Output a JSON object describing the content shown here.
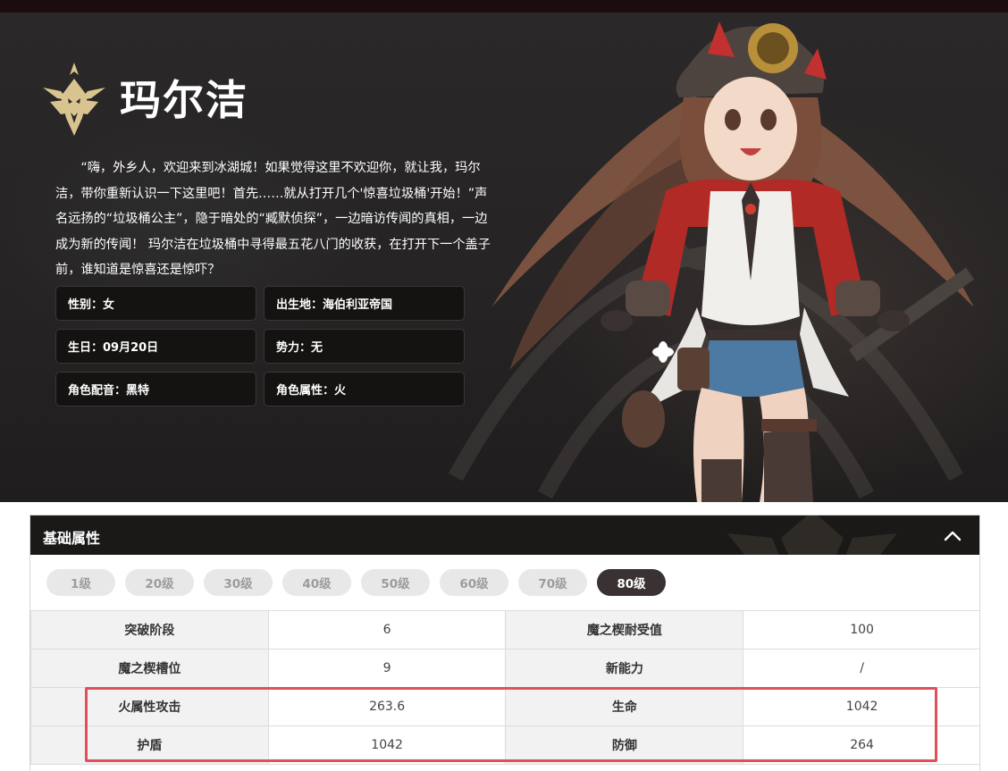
{
  "character": {
    "name": "玛尔洁",
    "bio": "“嗨，外乡人，欢迎来到冰湖城！如果觉得这里不欢迎你，就让我，玛尔洁，带你重新认识一下这里吧！首先……就从打开几个'惊喜垃圾桶'开始！”声名远扬的“垃圾桶公主”，隐于暗处的“臧默侦探”，一边暗访传闻的真相，一边成为新的传闻！ 玛尔洁在垃圾桶中寻得最五花八门的收获，在打开下一个盖子前，谁知道是惊喜还是惊吓？",
    "info": [
      {
        "label": "性别：女"
      },
      {
        "label": "出生地：海伯利亚帝国"
      },
      {
        "label": "生日：09月20日"
      },
      {
        "label": "势力：无"
      },
      {
        "label": "角色配音：黑特"
      },
      {
        "label": "角色属性：火"
      }
    ]
  },
  "panel": {
    "title": "基础属性",
    "levels": [
      "1级",
      "20级",
      "30级",
      "40级",
      "50级",
      "60级",
      "70级",
      "80级"
    ],
    "selected_level": "80级",
    "rows": [
      {
        "k1": "突破阶段",
        "v1": "6",
        "k2": "魔之楔耐受值",
        "v2": "100"
      },
      {
        "k1": "魔之楔槽位",
        "v1": "9",
        "k2": "新能力",
        "v2": "/"
      },
      {
        "k1": "火属性攻击",
        "v1": "263.6",
        "k2": "生命",
        "v2": "1042"
      },
      {
        "k1": "护盾",
        "v1": "1042",
        "k2": "防御",
        "v2": "264"
      }
    ]
  },
  "colors": {
    "hero_bg": "#262424",
    "emblem_gold": "#d9c48f",
    "active_level": "#3a3232",
    "highlight": "#e0505a"
  },
  "icons": {
    "emblem": "demon-crest-emblem-icon",
    "collapse": "chevron-up-icon"
  }
}
